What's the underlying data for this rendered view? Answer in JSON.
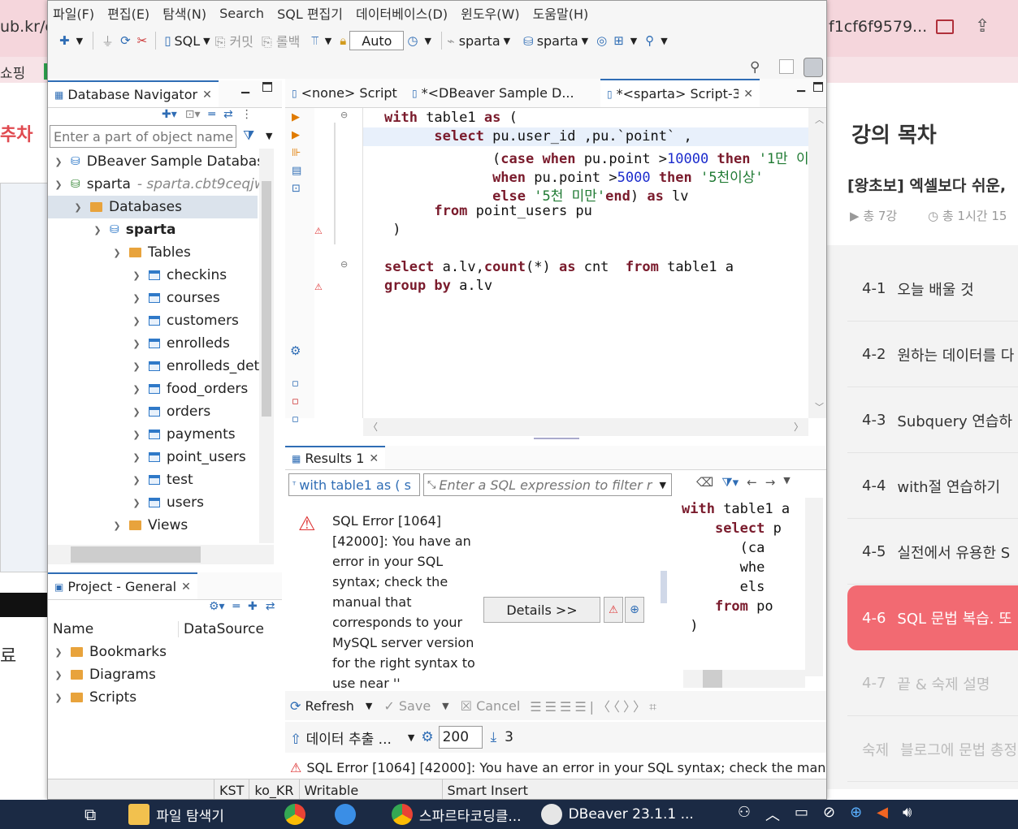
{
  "background": {
    "url_fragment": "ub.kr/e",
    "tab_fragment": "f1cf6f9579...",
    "bookmark_fragment": "쇼핑",
    "left_title_fragment": "추차",
    "left_footer_fragment": "료",
    "course_panel": {
      "heading": "강의 목차",
      "course_title": "[왕초보] 엑셀보다 쉬운,",
      "meta_lessons": "총 7강",
      "meta_time": "총 1시간 15",
      "lessons": [
        {
          "num": "4-1",
          "label": "오늘 배울 것",
          "state": "normal"
        },
        {
          "num": "4-2",
          "label": "원하는 데이터를 다",
          "state": "normal"
        },
        {
          "num": "4-3",
          "label": "Subquery 연습하",
          "state": "normal"
        },
        {
          "num": "4-4",
          "label": "with절 연습하기",
          "state": "normal"
        },
        {
          "num": "4-5",
          "label": "실전에서 유용한 S",
          "state": "normal"
        },
        {
          "num": "4-6",
          "label": "SQL 문법 복습. 또",
          "state": "active"
        },
        {
          "num": "4-7",
          "label": "끝 & 숙제 설명",
          "state": "dim"
        },
        {
          "num": "숙제",
          "label": "블로그에 문법 총정",
          "state": "dim"
        }
      ]
    }
  },
  "menu": [
    "파일(F)",
    "편집(E)",
    "탐색(N)",
    "Search",
    "SQL 편집기",
    "데이터베이스(D)",
    "윈도우(W)",
    "도움말(H)"
  ],
  "toolbar": {
    "sql_label": "SQL",
    "commit_label": "커밋",
    "rollback_label": "롤백",
    "mode_value": "Auto",
    "datasource_label": "sparta",
    "schema_label": "sparta"
  },
  "navigator": {
    "tab_label": "Database Navigator",
    "filter_placeholder": "Enter a part of object name",
    "nodes": {
      "sample_db": "DBeaver Sample Database",
      "sparta_conn": "sparta",
      "sparta_host": "- sparta.cbt9ceqjw",
      "databases": "Databases",
      "sparta_db": "sparta",
      "tables": "Tables",
      "views": "Views"
    },
    "tables": [
      "checkins",
      "courses",
      "customers",
      "enrolleds",
      "enrolleds_deta",
      "food_orders",
      "orders",
      "payments",
      "point_users",
      "test",
      "users"
    ]
  },
  "project": {
    "tab_label": "Project - General",
    "col_name": "Name",
    "col_datasource": "DataSource",
    "items": [
      "Bookmarks",
      "Diagrams",
      "Scripts"
    ]
  },
  "editor_tabs": [
    {
      "label": "<none> Script",
      "active": false
    },
    {
      "label": "*<DBeaver Sample D...",
      "active": false
    },
    {
      "label": "*<sparta> Script-3",
      "active": true
    }
  ],
  "results": {
    "tab_label": "Results 1",
    "query_preview": "with table1 as ( s",
    "filter_placeholder": "Enter a SQL expression to filter r",
    "error_text": "SQL Error [1064] [42000]: You have an error in your SQL syntax; check the manual that corresponds to your MySQL server version for the right syntax to use near ''",
    "details_button": "Details >>",
    "side_code": [
      "with table1 a",
      "    select p",
      "       (ca",
      "       whe",
      "       els",
      "    from po",
      " )"
    ],
    "bottom_bar": {
      "refresh": "Refresh",
      "save": "Save",
      "cancel": "Cancel",
      "export": "데이터 추출 ...",
      "fetch_size": "200",
      "row_count": "3"
    },
    "status_error": "SQL Error [1064] [42000]: You have an error in your SQL syntax; check the manua"
  },
  "status_bar": {
    "timezone": "KST",
    "locale": "ko_KR",
    "mode": "Writable",
    "insert_mode": "Smart Insert"
  },
  "taskbar": {
    "explorer": "파일 탐색기",
    "chrome_tab": "스파르타코딩클...",
    "dbeaver": "DBeaver 23.1.1 ..."
  },
  "colors": {
    "accent": "#2f6db5",
    "keyword": "#7a1b2c",
    "number": "#1c2ccd",
    "string": "#1f7a33",
    "active_lesson": "#f26a72",
    "taskbar": "#1b2a44"
  }
}
